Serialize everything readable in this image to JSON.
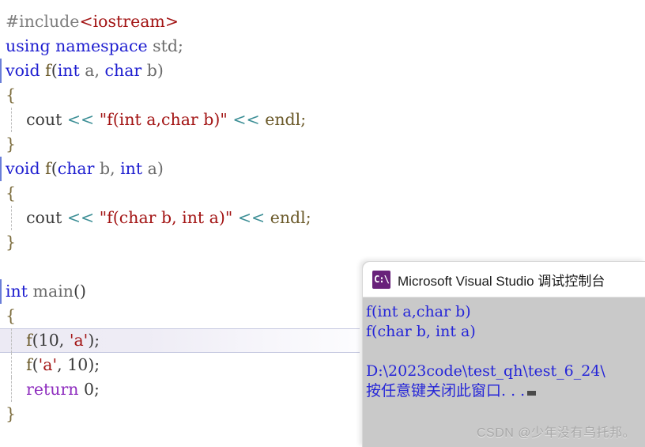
{
  "editor": {
    "language": "cpp",
    "current_line_index": 14,
    "lines": [
      {
        "indent": 0,
        "tokens": [
          {
            "text": "#include",
            "cls": "t-pre"
          },
          {
            "text": "<iostream>",
            "cls": "t-str"
          }
        ]
      },
      {
        "indent": 0,
        "tokens": [
          {
            "text": "using namespace",
            "cls": "t-kw"
          },
          {
            "text": " std;",
            "cls": "t-gray"
          }
        ]
      },
      {
        "indent": 0,
        "outline": true,
        "tokens": [
          {
            "text": "void",
            "cls": "t-kw"
          },
          {
            "text": " ",
            "cls": "t-plain"
          },
          {
            "text": "f",
            "cls": "t-fn"
          },
          {
            "text": "(",
            "cls": "t-plain"
          },
          {
            "text": "int",
            "cls": "t-kw"
          },
          {
            "text": " a, ",
            "cls": "t-gray"
          },
          {
            "text": "char",
            "cls": "t-kw"
          },
          {
            "text": " b)",
            "cls": "t-gray"
          }
        ]
      },
      {
        "indent": 0,
        "tokens": [
          {
            "text": "{",
            "cls": "t-brace"
          }
        ]
      },
      {
        "indent": 0,
        "guide": true,
        "tokens": [
          {
            "text": "    cout ",
            "cls": "t-plain"
          },
          {
            "text": "<<",
            "cls": "t-op"
          },
          {
            "text": " ",
            "cls": "t-plain"
          },
          {
            "text": "\"f(int a,char b)\"",
            "cls": "t-str"
          },
          {
            "text": " ",
            "cls": "t-plain"
          },
          {
            "text": "<<",
            "cls": "t-op"
          },
          {
            "text": " endl;",
            "cls": "t-fn"
          }
        ]
      },
      {
        "indent": 0,
        "tokens": [
          {
            "text": "}",
            "cls": "t-brace"
          }
        ]
      },
      {
        "indent": 0,
        "outline": true,
        "tokens": [
          {
            "text": "void",
            "cls": "t-kw"
          },
          {
            "text": " ",
            "cls": "t-plain"
          },
          {
            "text": "f",
            "cls": "t-fn"
          },
          {
            "text": "(",
            "cls": "t-plain"
          },
          {
            "text": "char",
            "cls": "t-kw"
          },
          {
            "text": " b, ",
            "cls": "t-gray"
          },
          {
            "text": "int",
            "cls": "t-kw"
          },
          {
            "text": " a)",
            "cls": "t-gray"
          }
        ]
      },
      {
        "indent": 0,
        "tokens": [
          {
            "text": "{",
            "cls": "t-brace"
          }
        ]
      },
      {
        "indent": 0,
        "guide": true,
        "tokens": [
          {
            "text": "    cout ",
            "cls": "t-plain"
          },
          {
            "text": "<<",
            "cls": "t-op"
          },
          {
            "text": " ",
            "cls": "t-plain"
          },
          {
            "text": "\"f(char b, int a)\"",
            "cls": "t-str"
          },
          {
            "text": " ",
            "cls": "t-plain"
          },
          {
            "text": "<<",
            "cls": "t-op"
          },
          {
            "text": " endl;",
            "cls": "t-fn"
          }
        ]
      },
      {
        "indent": 0,
        "tokens": [
          {
            "text": "}",
            "cls": "t-brace"
          }
        ]
      },
      {
        "indent": 0,
        "tokens": []
      },
      {
        "indent": 0,
        "outline": true,
        "tokens": [
          {
            "text": "int",
            "cls": "t-kw"
          },
          {
            "text": " ",
            "cls": "t-plain"
          },
          {
            "text": "main",
            "cls": "t-gray"
          },
          {
            "text": "()",
            "cls": "t-plain"
          }
        ]
      },
      {
        "indent": 0,
        "tokens": [
          {
            "text": "{",
            "cls": "t-brace"
          }
        ]
      },
      {
        "indent": 0,
        "guide": true,
        "highlight": true,
        "tokens": [
          {
            "text": "    ",
            "cls": "t-plain"
          },
          {
            "text": "f",
            "cls": "t-fn"
          },
          {
            "text": "(",
            "cls": "t-plain"
          },
          {
            "text": "10",
            "cls": "t-num"
          },
          {
            "text": ", ",
            "cls": "t-plain"
          },
          {
            "text": "'a'",
            "cls": "t-str"
          },
          {
            "text": ");",
            "cls": "t-plain"
          }
        ]
      },
      {
        "indent": 0,
        "guide": true,
        "tokens": [
          {
            "text": "    ",
            "cls": "t-plain"
          },
          {
            "text": "f",
            "cls": "t-fn"
          },
          {
            "text": "(",
            "cls": "t-plain"
          },
          {
            "text": "'a'",
            "cls": "t-str"
          },
          {
            "text": ", ",
            "cls": "t-plain"
          },
          {
            "text": "10",
            "cls": "t-num"
          },
          {
            "text": ");",
            "cls": "t-plain"
          }
        ]
      },
      {
        "indent": 0,
        "guide": true,
        "tokens": [
          {
            "text": "    ",
            "cls": "t-plain"
          },
          {
            "text": "return",
            "cls": "t-ctrl"
          },
          {
            "text": " ",
            "cls": "t-plain"
          },
          {
            "text": "0",
            "cls": "t-num"
          },
          {
            "text": ";",
            "cls": "t-plain"
          }
        ]
      },
      {
        "indent": 0,
        "tokens": [
          {
            "text": "}",
            "cls": "t-brace"
          }
        ]
      }
    ]
  },
  "console": {
    "icon": "console-cpp-icon",
    "icon_glyph": "C:\\",
    "title": "Microsoft Visual Studio 调试控制台",
    "output_lines": [
      "f(int a,char b)",
      "f(char b, int a)",
      "",
      "D:\\2023code\\test_qh\\test_6_24\\",
      "按任意键关闭此窗口. . ."
    ],
    "cursor_visible": true
  },
  "watermark": {
    "text": "CSDN @少年没有乌托邦。"
  },
  "colors": {
    "editor_bg": "#ffffff",
    "keyword": "#1f1fd0",
    "string": "#a31515",
    "operator": "#3d8f96",
    "control": "#8f2fbf",
    "preprocessor": "#7f7f7f",
    "console_bg": "#c9c9c9",
    "console_text": "#2525d8",
    "console_titlebar": "#ffffff",
    "icon_bg": "#68217a",
    "current_line_bg": "#eceaf4",
    "current_line_border": "#c6c9e0",
    "outline_bar": "#6a7ed8"
  }
}
